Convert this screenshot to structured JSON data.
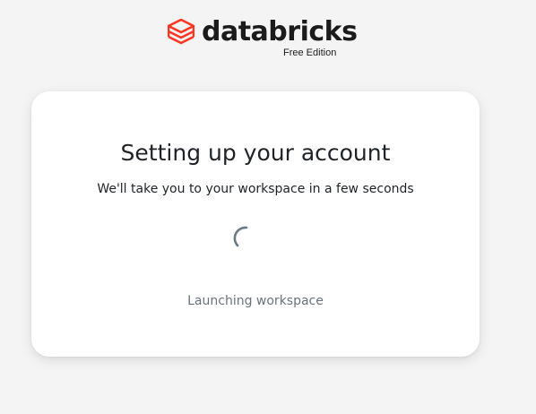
{
  "brand": {
    "wordmark": "databricks",
    "edition": "Free Edition",
    "logo_icon": "databricks-stacked-layers-logo",
    "accent_color": "#ff3621"
  },
  "card": {
    "title": "Setting up your account",
    "subtitle": "We'll take you to your workspace in a few seconds",
    "spinner_icon": "loading-spinner-icon",
    "status": "Launching workspace"
  }
}
